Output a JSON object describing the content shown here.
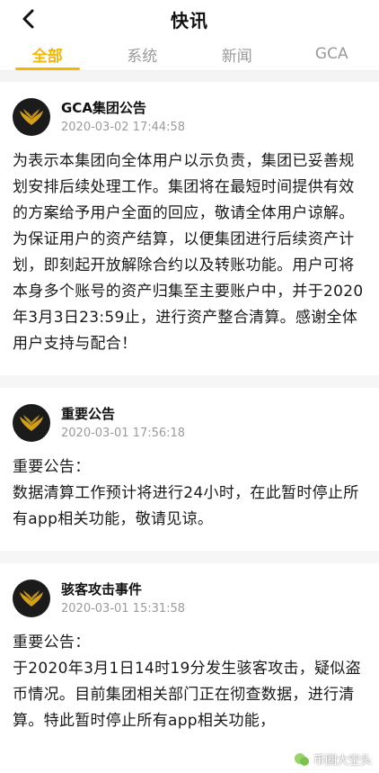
{
  "header": {
    "title": "快讯"
  },
  "tabs": [
    {
      "label": "全部",
      "active": true
    },
    {
      "label": "系统",
      "active": false
    },
    {
      "label": "新闻",
      "active": false
    },
    {
      "label": "GCA",
      "active": false
    }
  ],
  "posts": [
    {
      "author": "GCA集团公告",
      "time": "2020-03-02 17:44:58",
      "paragraphs": [
        "为表示本集团向全体用户以示负责，集团已妥善规划安排后续处理工作。集团将在最短时间提供有效的方案给予用户全面的回应，敬请全体用户谅解。",
        "为保证用户的资产结算，以便集团进行后续资产计划，即刻起开放解除合约以及转账功能。用户可将本身多个账号的资产归集至主要账户中，并于2020年3月3日23:59止，进行资产整合清算。感谢全体用户支持与配合！"
      ]
    },
    {
      "author": "重要公告",
      "time": "2020-03-01 17:56:18",
      "paragraphs": [
        "重要公告：",
        "数据清算工作预计将进行24小时，在此暂时停止所有app相关功能，敬请见谅。"
      ]
    },
    {
      "author": "骇客攻击事件",
      "time": "2020-03-01 15:31:58",
      "paragraphs": [
        "重要公告：",
        "于2020年3月1日14时19分发生骇客攻击，疑似盗币情况。目前集团相关部门正在彻查数据，进行清算。特此暂时停止所有app相关功能，"
      ]
    }
  ],
  "watermark": {
    "text": "币圈大空头"
  },
  "colors": {
    "accent": "#f5b800",
    "logo_bg": "#1b1b1b",
    "logo_gold": "#d4a017"
  }
}
